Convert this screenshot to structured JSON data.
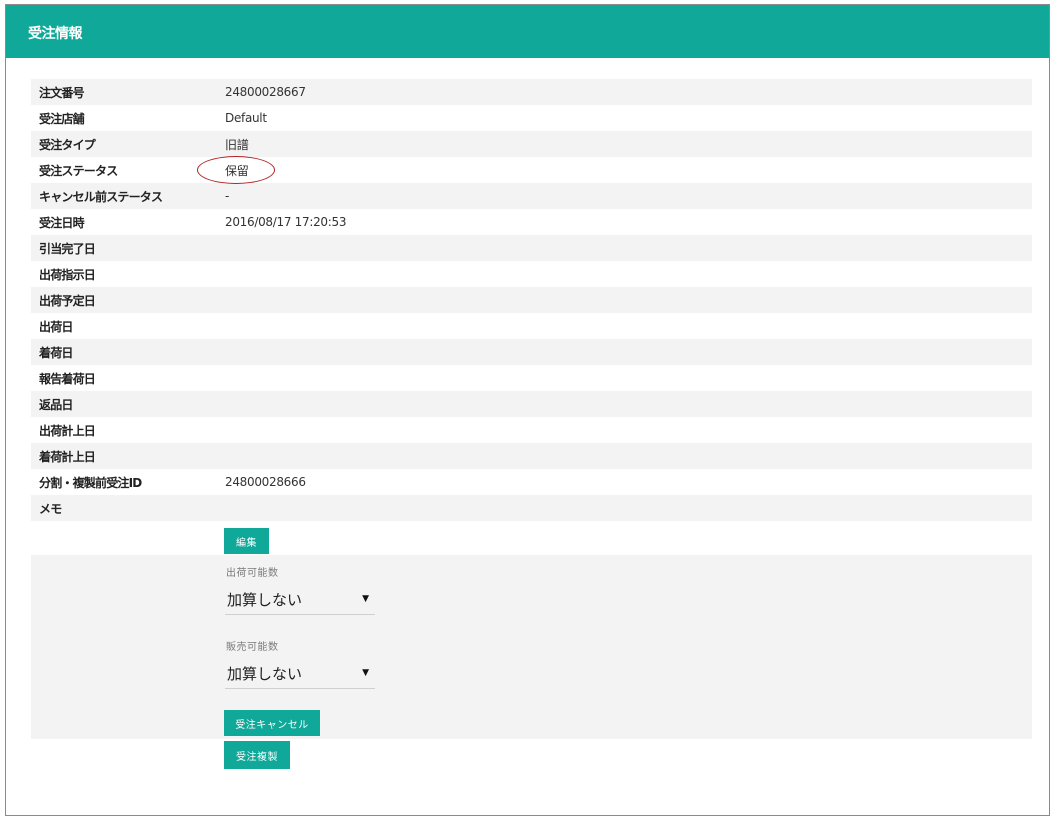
{
  "header": {
    "title": "受注情報"
  },
  "details": [
    {
      "label": "注文番号",
      "value": "24800028667"
    },
    {
      "label": "受注店舗",
      "value": "Default"
    },
    {
      "label": "受注タイプ",
      "value": "旧譜"
    },
    {
      "label": "受注ステータス",
      "value": "保留"
    },
    {
      "label": "キャンセル前ステータス",
      "value": "-"
    },
    {
      "label": "受注日時",
      "value": "2016/08/17 17:20:53"
    },
    {
      "label": "引当完了日",
      "value": ""
    },
    {
      "label": "出荷指示日",
      "value": ""
    },
    {
      "label": "出荷予定日",
      "value": ""
    },
    {
      "label": "出荷日",
      "value": ""
    },
    {
      "label": "着荷日",
      "value": ""
    },
    {
      "label": "報告着荷日",
      "value": ""
    },
    {
      "label": "返品日",
      "value": ""
    },
    {
      "label": "出荷計上日",
      "value": ""
    },
    {
      "label": "着荷計上日",
      "value": ""
    },
    {
      "label": "分割・複製前受注ID",
      "value": "24800028666"
    },
    {
      "label": "メモ",
      "value": ""
    }
  ],
  "actions": {
    "edit_label": "編集",
    "shippable": {
      "label": "出荷可能数",
      "selected": "加算しない"
    },
    "sellable": {
      "label": "販売可能数",
      "selected": "加算しない"
    },
    "cancel_label": "受注キャンセル",
    "duplicate_label": "受注複製"
  },
  "colors": {
    "accent": "#0fa899",
    "highlight_circle": "#b22222"
  }
}
